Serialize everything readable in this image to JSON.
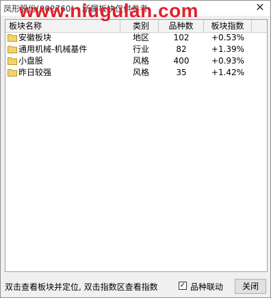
{
  "window": {
    "title": "凤形股份(002760) - 所属板块仅供参考",
    "close_symbol": "✕"
  },
  "watermark": "www.niugulan.com",
  "table": {
    "columns": [
      "板块名称",
      "类别",
      "品种数",
      "板块指数"
    ],
    "rows": [
      {
        "name": "安徽板块",
        "category": "地区",
        "count": "102",
        "change": "+0.53%"
      },
      {
        "name": "通用机械-机械基件",
        "category": "行业",
        "count": "82",
        "change": "+1.39%"
      },
      {
        "name": "小盘股",
        "category": "风格",
        "count": "400",
        "change": "+0.93%"
      },
      {
        "name": "昨日较强",
        "category": "风格",
        "count": "35",
        "change": "+1.42%"
      }
    ]
  },
  "status": {
    "hint": "双击查看板块并定位, 双击指数区查看指数",
    "checkbox_label": "品种联动",
    "checkbox_checked": true,
    "close_button": "关闭"
  },
  "colors": {
    "watermark": "#e3202c",
    "folder": "#f2d46b"
  }
}
